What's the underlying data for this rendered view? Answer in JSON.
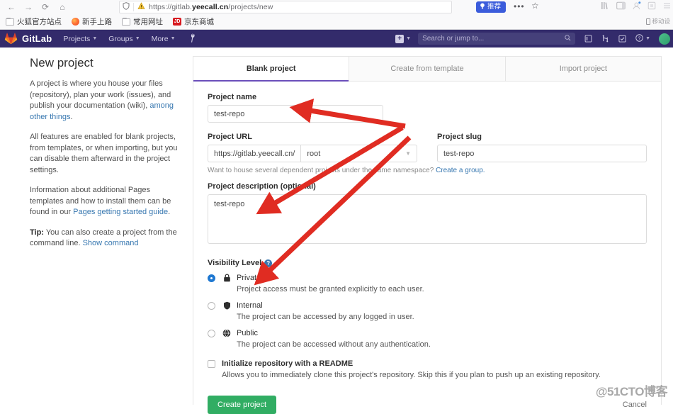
{
  "browser": {
    "nav_back": "←",
    "nav_forward": "→",
    "nav_reload": "⟳",
    "nav_home": "⌂",
    "shield_icon": "shield",
    "url_prefix": "https://gitlab.",
    "url_domain": "yeecall.cn",
    "url_path": "/projects/new",
    "url_full": "https://gitlab.yeecall.cn/projects/new",
    "recommend_badge": "推荐",
    "dots_label": "•••",
    "star_label": "☆",
    "mobile_hint": "移动设",
    "bookmarks": [
      {
        "label": "火狐官方站点",
        "icon": "folder-icon"
      },
      {
        "label": "新手上路",
        "icon": "firefox-icon"
      },
      {
        "label": "常用网址",
        "icon": "folder-icon"
      },
      {
        "label": "京东商城",
        "icon": "jd-icon"
      }
    ]
  },
  "gitlab_nav": {
    "brand": "GitLab",
    "items": [
      {
        "label": "Projects",
        "caret": "▼"
      },
      {
        "label": "Groups",
        "caret": "▼"
      },
      {
        "label": "More",
        "caret": "▼"
      }
    ],
    "wrench": "⚒",
    "plus_label": "+",
    "plus_caret": "▼",
    "search_placeholder": "Search or jump to...",
    "search_icon": "🔍",
    "right_icons": [
      {
        "name": "issues-icon",
        "glyph": "◫"
      },
      {
        "name": "merge-requests-icon",
        "glyph": "⑂"
      },
      {
        "name": "todos-icon",
        "glyph": "☑"
      }
    ],
    "help_glyph": "?",
    "help_caret": "▼"
  },
  "sidebar": {
    "title": "New project",
    "paragraph1_before": "A project is where you house your files (repository), plan your work (issues), and publish your documentation (wiki), ",
    "paragraph1_link": "among other things",
    "paragraph1_after": ".",
    "paragraph2": "All features are enabled for blank projects, from templates, or when importing, but you can disable them afterward in the project settings.",
    "paragraph3_before": "Information about additional Pages templates and how to install them can be found in our ",
    "paragraph3_link": "Pages getting started guide",
    "paragraph3_after": ".",
    "tip_bold": "Tip:",
    "tip_text": " You can also create a project from the command line. ",
    "tip_link": "Show command"
  },
  "tabs": [
    {
      "label": "Blank project",
      "active": true
    },
    {
      "label": "Create from template",
      "active": false
    },
    {
      "label": "Import project",
      "active": false
    }
  ],
  "form": {
    "project_name_label": "Project name",
    "project_name_value": "test-repo",
    "project_url_label": "Project URL",
    "project_url_prefix": "https://gitlab.yeecall.cn/",
    "project_url_namespace": "root",
    "project_slug_label": "Project slug",
    "project_slug_value": "test-repo",
    "namespace_hint_before": "Want to house several dependent projects under the same namespace? ",
    "namespace_hint_link": "Create a group.",
    "description_label": "Project description (optional)",
    "description_value": "test-repo",
    "visibility_label": "Visibility Level",
    "visibility_help": "?",
    "visibility_options": [
      {
        "name": "Private",
        "icon": "lock-icon",
        "description": "Project access must be granted explicitly to each user.",
        "selected": true
      },
      {
        "name": "Internal",
        "icon": "shield-icon",
        "description": "The project can be accessed by any logged in user.",
        "selected": false
      },
      {
        "name": "Public",
        "icon": "globe-icon",
        "description": "The project can be accessed without any authentication.",
        "selected": false
      }
    ],
    "readme_label": "Initialize repository with a README",
    "readme_checked": false,
    "readme_description": "Allows you to immediately clone this project's repository. Skip this if you plan to push up an existing repository.",
    "create_button": "Create project",
    "cancel_link": "Cancel"
  },
  "watermark": "@51CTO博客",
  "colors": {
    "gitlab_navbar": "#332b6b",
    "tab_active_underline": "#6b4fbb",
    "create_button": "#31ad63",
    "link": "#3777b0",
    "radio_selected": "#1f78d1",
    "annotation_arrow": "#e02c22",
    "recommend_badge": "#3b5cdb"
  }
}
